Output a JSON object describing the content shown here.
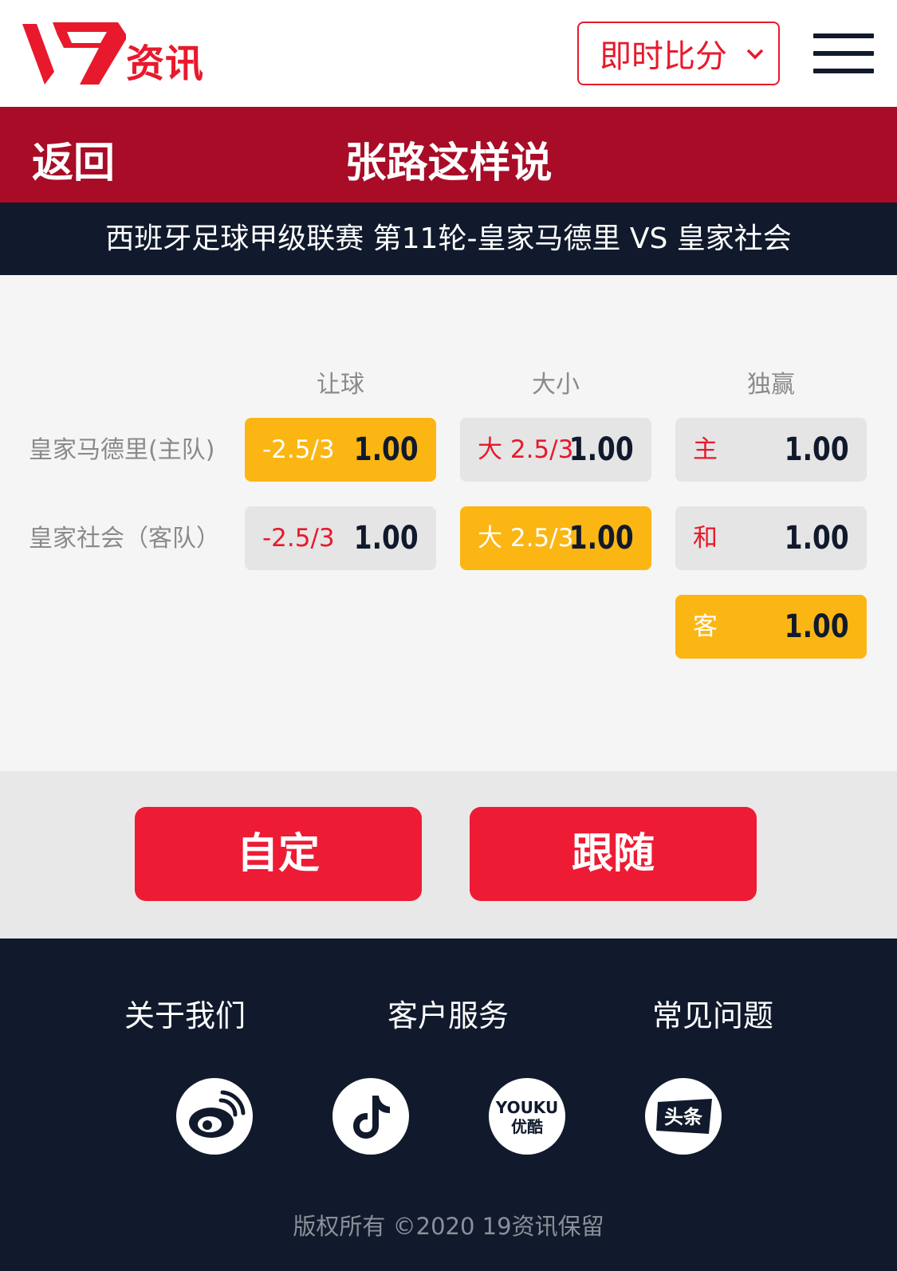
{
  "header": {
    "logo_text": "资讯",
    "dropdown_label": "即时比分"
  },
  "titlebar": {
    "back_label": "返回",
    "title": "张路这样说"
  },
  "match": {
    "title": "西班牙足球甲级联赛 第11轮-皇家马德里 VS 皇家社会"
  },
  "odds": {
    "columns": [
      "让球",
      "大小",
      "独赢"
    ],
    "teams": [
      "皇家马德里(主队)",
      "皇家社会（客队）"
    ],
    "handicap": [
      {
        "label": "-2.5/3",
        "value": "1.00",
        "selected": true
      },
      {
        "label": "-2.5/3",
        "value": "1.00",
        "selected": false
      }
    ],
    "overunder": [
      {
        "label": "大 2.5/3",
        "value": "1.00",
        "selected": false
      },
      {
        "label": "大 2.5/3",
        "value": "1.00",
        "selected": true
      }
    ],
    "moneyline": [
      {
        "label": "主",
        "value": "1.00",
        "selected": false
      },
      {
        "label": "和",
        "value": "1.00",
        "selected": false
      },
      {
        "label": "客",
        "value": "1.00",
        "selected": true
      }
    ]
  },
  "actions": {
    "custom_label": "自定",
    "follow_label": "跟随"
  },
  "footer": {
    "links": [
      "关于我们",
      "客户服务",
      "常见问题"
    ],
    "social": [
      "weibo-icon",
      "tiktok-icon",
      "youku-icon",
      "toutiao-icon"
    ],
    "youku_top": "YOUKU",
    "youku_bottom": "优酷",
    "toutiao_text": "头条",
    "copyright": "版权所有 ©2020 19资讯保留"
  },
  "colors": {
    "brand_red": "#e8192c",
    "title_red": "#a80c27",
    "navy": "#111a2c",
    "selected_yellow": "#fbb614"
  }
}
